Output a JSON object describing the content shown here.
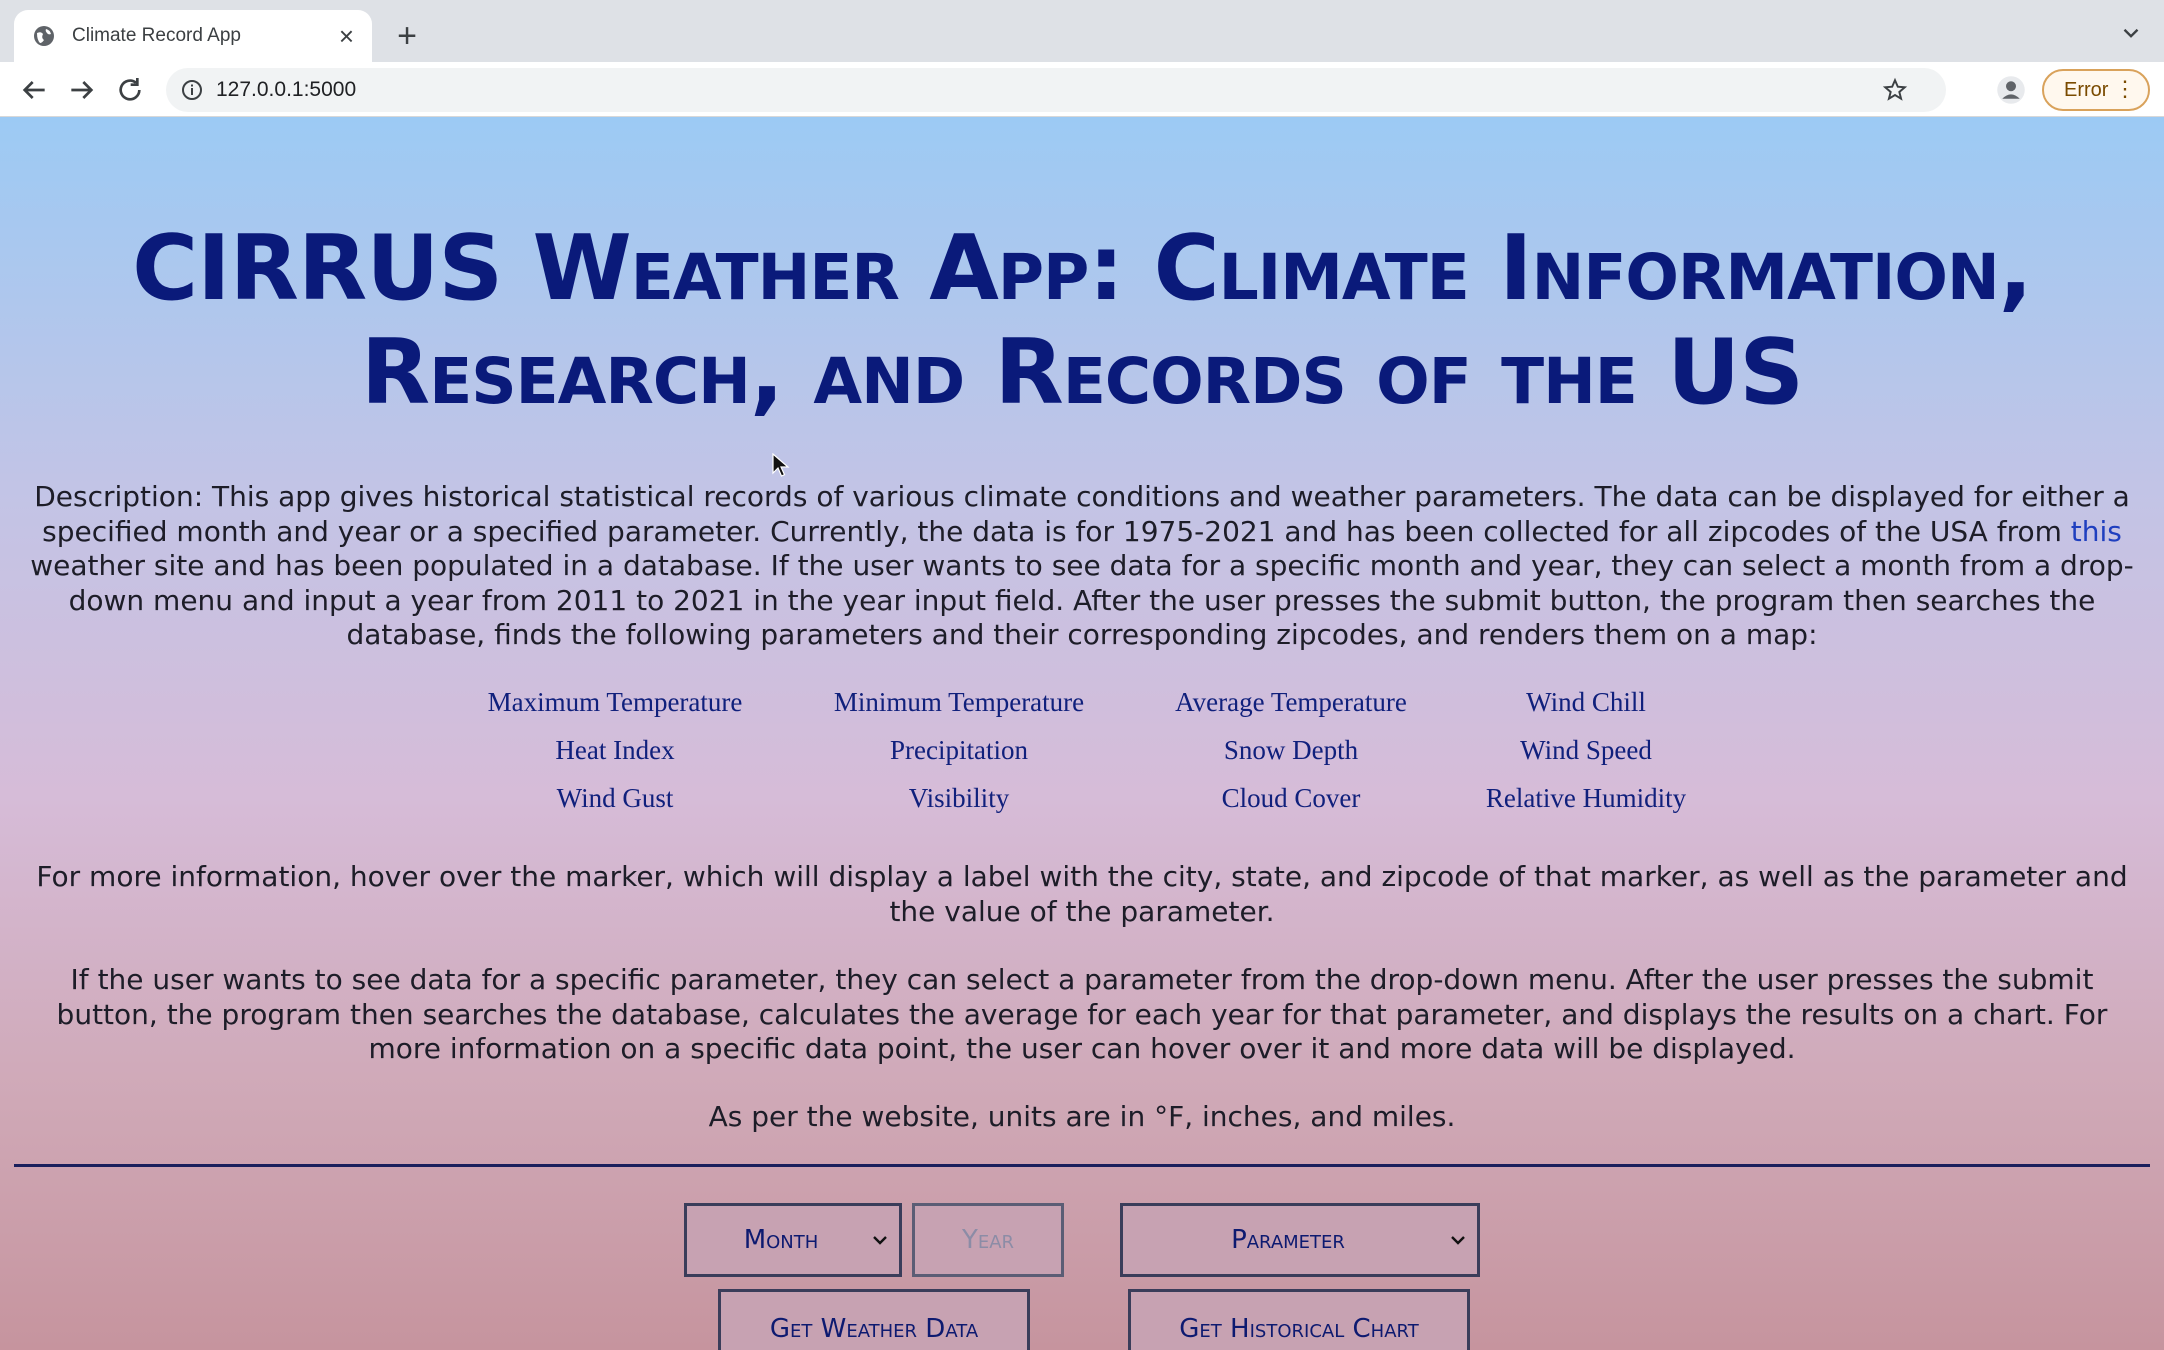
{
  "browser": {
    "tab_title": "Climate Record App",
    "tab_close": "×",
    "new_tab": "+",
    "url": "127.0.0.1:5000",
    "error_label": "Error",
    "error_menu": "⋮"
  },
  "page": {
    "title": "CIRRUS Weather App: Climate Information, Research, and Records of the US",
    "description_1": {
      "before_link": "Description: This app gives historical statistical records of various climate conditions and weather parameters. The data can be displayed for either a specified month and year or a specified parameter. Currently, the data is for 1975-2021 and has been collected for all zipcodes of the USA from ",
      "link": "this",
      "after_link": " weather site and has been populated in a database. If the user wants to see data for a specific month and year, they can select a month from a drop-down menu and input a year from 2011 to 2021 in the year input field. After the user presses the submit button, the program then searches the database, finds the following parameters and their corresponding zipcodes, and renders them on a map:"
    },
    "parameters": [
      "Maximum Temperature",
      "Minimum Temperature",
      "Average Temperature",
      "Wind Chill",
      "Heat Index",
      "Precipitation",
      "Snow Depth",
      "Wind Speed",
      "Wind Gust",
      "Visibility",
      "Cloud Cover",
      "Relative Humidity"
    ],
    "description_2": "For more information, hover over the marker, which will display a label with the city, state, and zipcode of that marker, as well as the parameter and the value of the parameter.",
    "description_3": "If the user wants to see data for a specific parameter, they can select a parameter from the drop-down menu. After the user presses the submit button, the program then searches the database, calculates the average for each year for that parameter, and displays the results on a chart. For more information on a specific data point, the user can hover over it and more data will be displayed.",
    "description_4": "As per the website, units are in °F, inches, and miles."
  },
  "form": {
    "month_selected": "Month",
    "year_placeholder": "Year",
    "parameter_selected": "Parameter",
    "get_weather_label": "Get Weather Data",
    "get_chart_label": "Get Historical Chart"
  },
  "colors": {
    "title": "#0a1a7a",
    "link": "#1f3fbf",
    "gradient_top": "#9ccaf4",
    "gradient_bottom": "#c6949e"
  }
}
